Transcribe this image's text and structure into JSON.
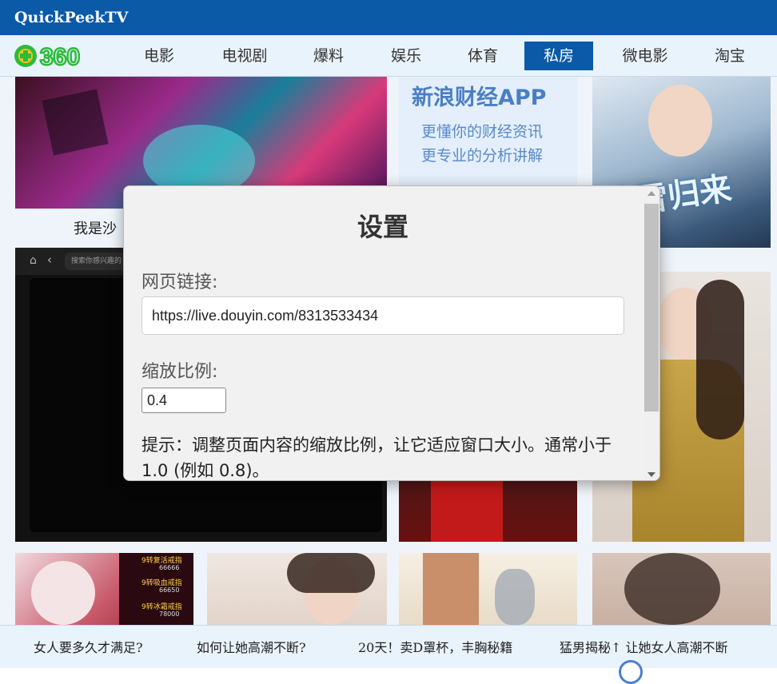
{
  "window": {
    "title": "QuickPeekTV"
  },
  "logo": {
    "text": "360"
  },
  "nav": {
    "items": [
      {
        "label": "电影"
      },
      {
        "label": "电视剧"
      },
      {
        "label": "爆料"
      },
      {
        "label": "娱乐"
      },
      {
        "label": "体育"
      },
      {
        "label": "私房"
      },
      {
        "label": "微电影"
      },
      {
        "label": "淘宝"
      }
    ],
    "active_index": 5
  },
  "content": {
    "caption_partial": "我是沙",
    "ad_card": {
      "title": "新浪财经APP",
      "line1": "更懂你的财经资讯",
      "line2": "更专业的分析讲解"
    },
    "game_poster_text": "冰雪归来",
    "browser_thumb": {
      "search_placeholder": "搜索你感兴趣的"
    },
    "game_badges": [
      "9转复活戒指",
      "9转吸血戒指",
      "9转冰霜戒指"
    ],
    "badge_values": [
      "66666",
      "66650",
      "78000"
    ]
  },
  "dialog": {
    "title": "设置",
    "url_label": "网页链接:",
    "url_value": "https://live.douyin.com/8313533434",
    "scale_label": "缩放比例:",
    "scale_value": "0.4",
    "hint": "提示：调整页面内容的缩放比例，让它适应窗口大小。通常小于 1.0 (例如 0.8)。"
  },
  "bottom_links": [
    "女人要多久才满足?",
    "如何让她高潮不断?",
    "20天！卖D罩杯，丰胸秘籍",
    "猛男揭秘↑ 让她女人高潮不断"
  ],
  "colors": {
    "brand": "#0a5aa8",
    "nav_bg": "#e9f3fc",
    "logo_green": "#2dbb3a",
    "logo_yellow": "#f7c21d"
  }
}
